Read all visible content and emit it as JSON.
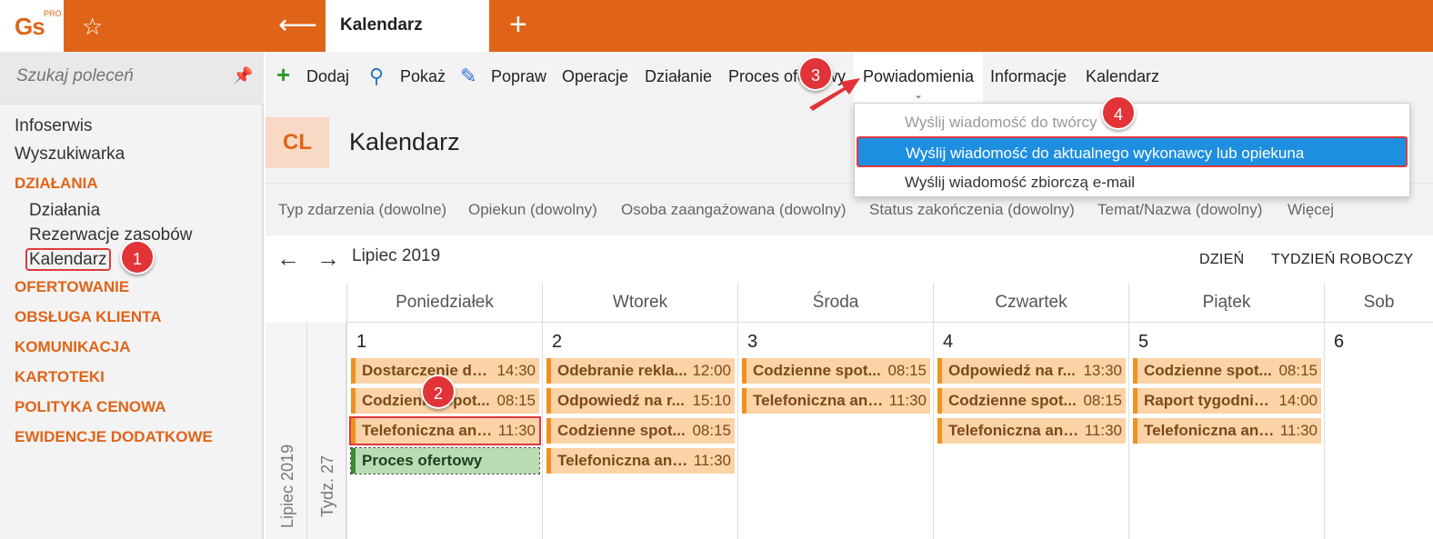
{
  "app": {
    "logo": "Gs",
    "logo_sup": "PRO",
    "active_tab": "Kalendarz"
  },
  "sidebar": {
    "search_placeholder": "Szukaj poleceń",
    "items": [
      "Infoserwis",
      "Wyszukiwarka"
    ],
    "section_dzialania": "DZIAŁANIA",
    "sub": [
      "Działania",
      "Rezerwacje zasobów",
      "Kalendarz"
    ],
    "sections": [
      "OFERTOWANIE",
      "OBSŁUGA KLIENTA",
      "KOMUNIKACJA",
      "KARTOTEKI",
      "POLITYKA CENOWA",
      "EWIDENCJE DODATKOWE"
    ]
  },
  "toolbar": {
    "add": "Dodaj",
    "show": "Pokaż",
    "edit": "Popraw",
    "operations": "Operacje",
    "action": "Działanie",
    "process": "Proces ofertowy",
    "notifications": "Powiadomienia",
    "info": "Informacje",
    "calendar": "Kalendarz"
  },
  "header": {
    "badge": "CL",
    "title": "Kalendarz"
  },
  "filters": [
    "Typ zdarzenia (dowolne)",
    "Opiekun (dowolny)",
    "Osoba zaangażowana (dowolny)",
    "Status zakończenia (dowolny)",
    "Temat/Nazwa (dowolny)",
    "Więcej"
  ],
  "calnav": {
    "month": "Lipiec 2019",
    "day_btn": "DZIEŃ",
    "week_btn": "TYDZIEŃ ROBOCZY"
  },
  "calendar": {
    "month_vertical": "Lipiec 2019",
    "week_vertical": "Tydz. 27",
    "days": [
      {
        "name": "Poniedziałek",
        "num": "1",
        "events": [
          {
            "n": "Dostarczenie du...",
            "t": "14:30"
          },
          {
            "n": "Codzienne spot...",
            "t": "08:15"
          },
          {
            "n": "Telefoniczna ank...",
            "t": "11:30"
          },
          {
            "n": "Proces ofertowy",
            "t": ""
          }
        ]
      },
      {
        "name": "Wtorek",
        "num": "2",
        "events": [
          {
            "n": "Odebranie rekla...",
            "t": "12:00"
          },
          {
            "n": "Odpowiedź na r...",
            "t": "15:10"
          },
          {
            "n": "Codzienne spot...",
            "t": "08:15"
          },
          {
            "n": "Telefoniczna ank...",
            "t": "11:30"
          }
        ]
      },
      {
        "name": "Środa",
        "num": "3",
        "events": [
          {
            "n": "Codzienne spot...",
            "t": "08:15"
          },
          {
            "n": "Telefoniczna ank...",
            "t": "11:30"
          }
        ]
      },
      {
        "name": "Czwartek",
        "num": "4",
        "events": [
          {
            "n": "Odpowiedź na r...",
            "t": "13:30"
          },
          {
            "n": "Codzienne spot...",
            "t": "08:15"
          },
          {
            "n": "Telefoniczna ank...",
            "t": "11:30"
          }
        ]
      },
      {
        "name": "Piątek",
        "num": "5",
        "events": [
          {
            "n": "Codzienne spot...",
            "t": "08:15"
          },
          {
            "n": "Raport tygodnio...",
            "t": "14:00"
          },
          {
            "n": "Telefoniczna ank...",
            "t": "11:30"
          }
        ]
      },
      {
        "name": "Sob",
        "num": "6",
        "events": []
      }
    ]
  },
  "dropdown": [
    "Wyślij wiadomość do twórcy",
    "Wyślij wiadomość do aktualnego wykonawcy lub opiekuna",
    "Wyślij wiadomość zbiorczą e-mail"
  ],
  "badges": [
    "1",
    "2",
    "3",
    "4"
  ]
}
